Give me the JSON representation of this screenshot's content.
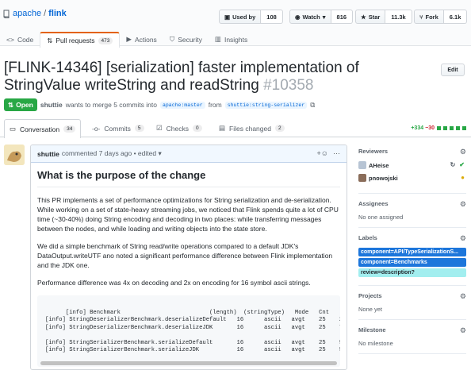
{
  "repo": {
    "owner": "apache",
    "name": "flink"
  },
  "actions": {
    "used_by": {
      "label": "Used by",
      "count": "108"
    },
    "watch": {
      "label": "Watch",
      "count": "816"
    },
    "star": {
      "label": "Star",
      "count": "11.3k"
    },
    "fork": {
      "label": "Fork",
      "count": "6.1k"
    }
  },
  "reponav": [
    {
      "label": "Code"
    },
    {
      "label": "Pull requests",
      "count": "473"
    },
    {
      "label": "Actions"
    },
    {
      "label": "Security"
    },
    {
      "label": "Insights"
    }
  ],
  "pr": {
    "title": "[FLINK-14346] [serialization] faster implementation of StringValue writeString and readString",
    "number": "#10358",
    "edit_label": "Edit",
    "state": "Open",
    "author": "shuttie",
    "merge_text": "wants to merge 5 commits into",
    "base_branch": "apache:master",
    "from_text": "from",
    "head_branch": "shuttie:string-serializer"
  },
  "prtabs": [
    {
      "label": "Conversation",
      "count": "34"
    },
    {
      "label": "Commits",
      "count": "5"
    },
    {
      "label": "Checks",
      "count": "0"
    },
    {
      "label": "Files changed",
      "count": "2"
    }
  ],
  "diffstat": {
    "additions": "+334",
    "deletions": "−30"
  },
  "colors": {
    "green": "#28a745",
    "red": "#cb2431",
    "label_blue": "#1d76db",
    "label_green": "#a2eeef"
  },
  "comment": {
    "author": "shuttie",
    "meta": "commented 7 days ago • edited ▾",
    "heading": "What is the purpose of the change",
    "p1": "This PR implements a set of performance optimizations for String serialization and de-serialization. While working on a set of state-heavy streaming jobs, we noticed that Flink spends quite a lot of CPU time (~30-40%) doing String encoding and decoding in two places: while transferring messages between the nodes, and while loading and writing objects into the state store.",
    "p2": "We did a simple benchmark of String read/write operations compared to a default JDK's DataOutput.writeUTF ano noted a significant performance difference between Flink implementation and the JDK one.",
    "p3": "Performance difference was 4x on decoding and 2x on encoding for 16 symbol ascii strings.",
    "code": "[info] Benchmark                          (length)  (stringType)   Mode   Cnt    Sc\n[info] StringDeserializerBenchmark.deserializeDefault   16      ascii   avgt    25    25\n[info] StringDeserializerBenchmark.deserializeJDK       16      ascii   avgt    25    77\n\n[info] StringSerializerBenchmark.serializeDefault       16      ascii   avgt    25    95\n[info] StringSerializerBenchmark.serializeJDK           16      ascii   avgt    25    50"
  },
  "sidebar": {
    "reviewers_h": "Reviewers",
    "reviewers": [
      "AHeise",
      "pnowojski"
    ],
    "assignees_h": "Assignees",
    "assignees_none": "No one assigned",
    "labels_h": "Labels",
    "labels": [
      "component=API/TypeSerializationS...",
      "component=Benchmarks",
      "review=description?"
    ],
    "projects_h": "Projects",
    "projects_none": "None yet",
    "milestone_h": "Milestone",
    "milestone_none": "No milestone"
  }
}
